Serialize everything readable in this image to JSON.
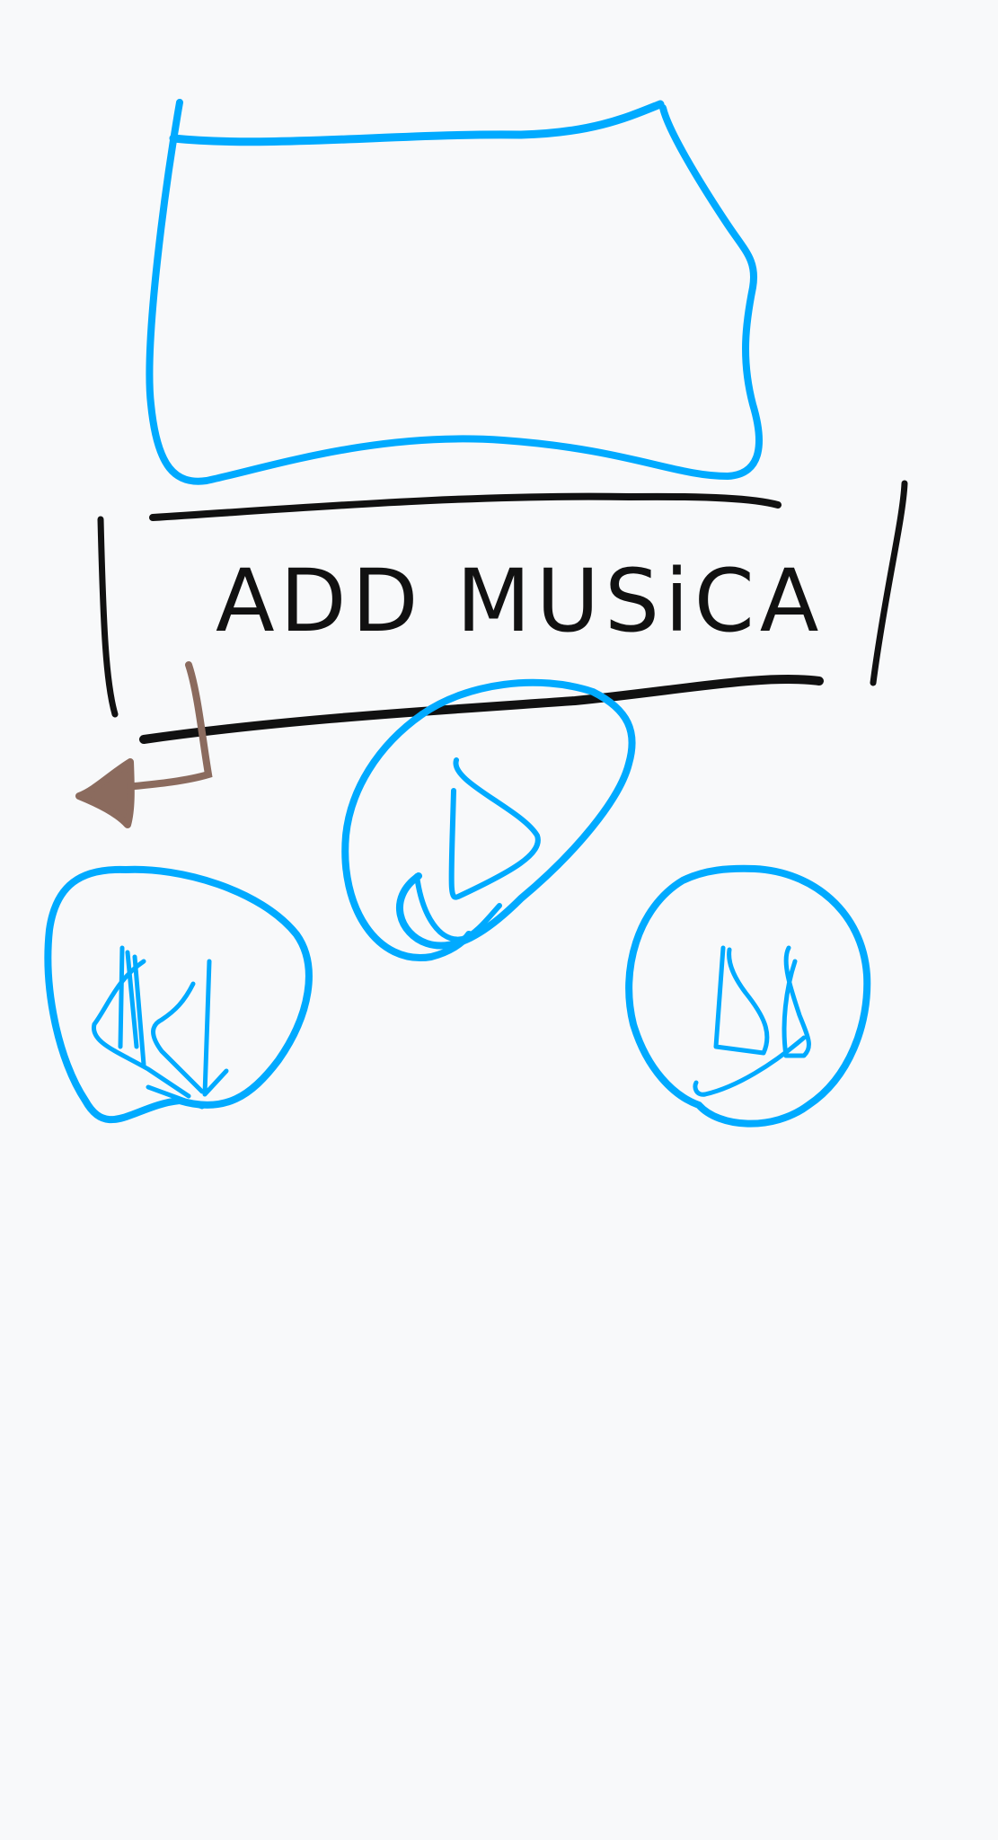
{
  "title": "ADD MUSiCA",
  "colors": {
    "background": "#f8f9fa",
    "sketch_blue": "#00aaff",
    "ink": "#111111",
    "back_arrow": "#8b6b5e"
  },
  "icons": {
    "back": "arrow-left-icon",
    "play": "play-icon",
    "previous": "previous-track-icon",
    "next": "next-track-icon"
  }
}
